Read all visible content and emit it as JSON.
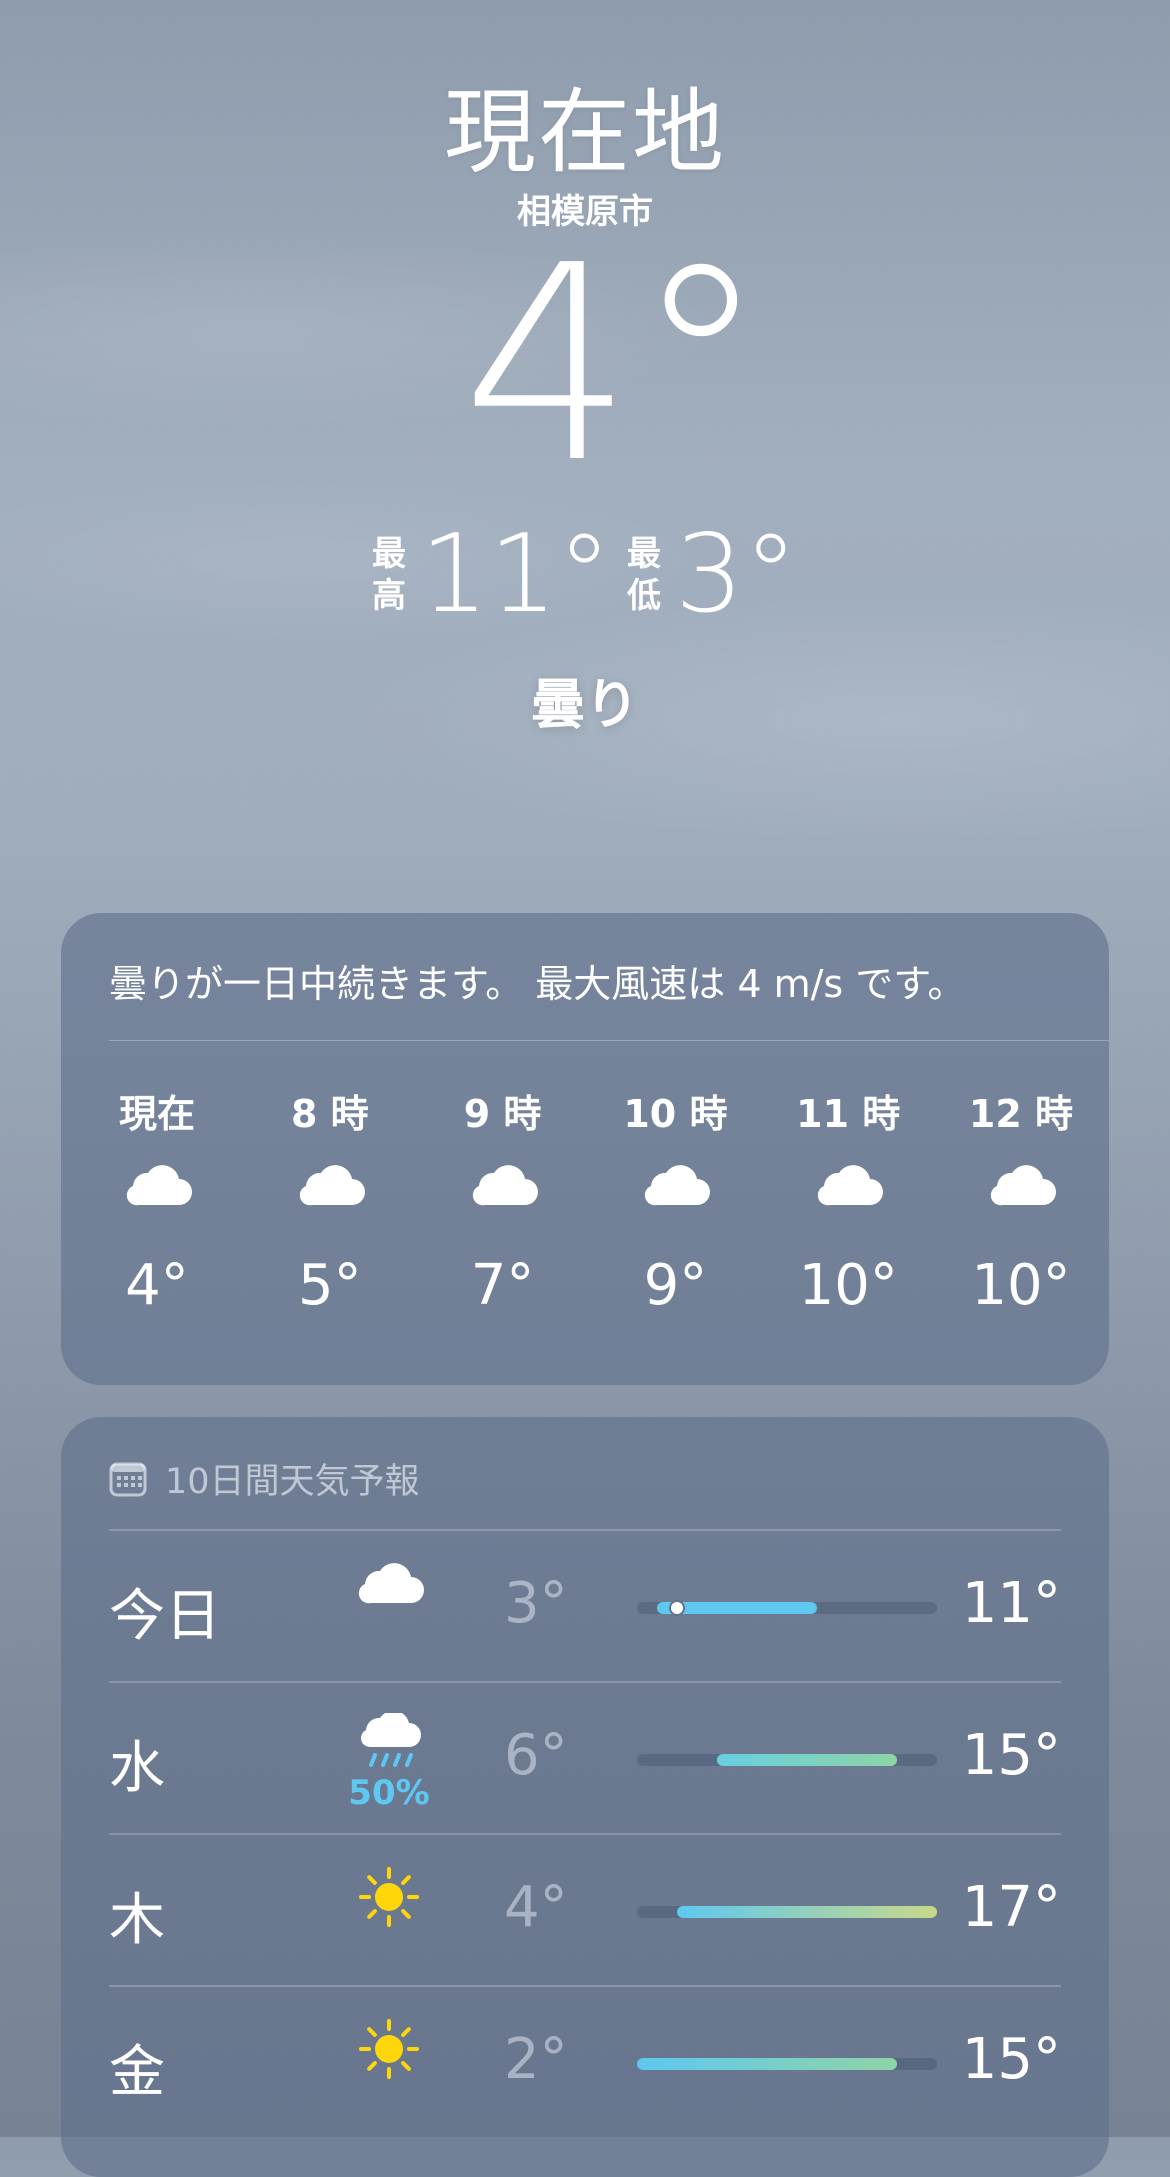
{
  "header": {
    "location": "現在地",
    "city": "相模原市",
    "temperature": "4°",
    "high_label_1": "最",
    "high_label_2": "高",
    "high_value": "11°",
    "low_label_1": "最",
    "low_label_2": "低",
    "low_value": "3°",
    "condition": "曇り"
  },
  "hourly_card": {
    "summary": "曇りが一日中続きます。 最大風速は 4 m/s です。",
    "hours": [
      {
        "time": "現在",
        "icon": "cloud-icon",
        "temp": "4°"
      },
      {
        "time": "8 時",
        "icon": "cloud-icon",
        "temp": "5°"
      },
      {
        "time": "9 時",
        "icon": "cloud-icon",
        "temp": "7°"
      },
      {
        "time": "10 時",
        "icon": "cloud-icon",
        "temp": "9°"
      },
      {
        "time": "11 時",
        "icon": "cloud-icon",
        "temp": "10°"
      },
      {
        "time": "12 時",
        "icon": "cloud-icon",
        "temp": "10°"
      }
    ]
  },
  "forecast_card": {
    "title": "10日間天気予報",
    "title_icon": "calendar-icon",
    "range_min": 2,
    "range_max": 17,
    "days": [
      {
        "day": "今日",
        "icon": "cloud-icon",
        "pop": "",
        "low": "3°",
        "high": "11°",
        "low_val": 3,
        "high_val": 11,
        "current_val": 4,
        "colors": [
          "#5ec8f0",
          "#5ec8f0"
        ]
      },
      {
        "day": "水",
        "icon": "cloud-rain-icon",
        "pop": "50%",
        "low": "6°",
        "high": "15°",
        "low_val": 6,
        "high_val": 15,
        "colors": [
          "#68cfe0",
          "#8ed4a6"
        ]
      },
      {
        "day": "木",
        "icon": "sun-icon",
        "pop": "",
        "low": "4°",
        "high": "17°",
        "low_val": 4,
        "high_val": 17,
        "colors": [
          "#5ec8f0",
          "#c8d88a"
        ]
      },
      {
        "day": "金",
        "icon": "sun-icon",
        "pop": "",
        "low": "2°",
        "high": "15°",
        "low_val": 2,
        "high_val": 15,
        "colors": [
          "#5ec8f0",
          "#8ed4a6"
        ]
      }
    ]
  },
  "colors": {
    "sun": "#ffd60a",
    "rain": "#5ec8f3",
    "card": "#5f708a"
  }
}
